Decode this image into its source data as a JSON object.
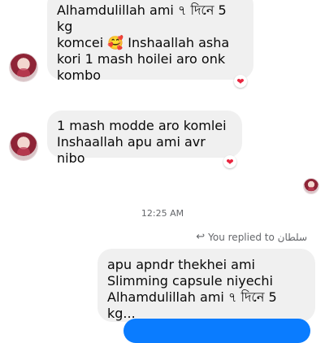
{
  "messages": [
    {
      "text": "Alhamdulillah ami ৭ দিনে 5 kg\nkomcei 🥰 Inshaallah asha\nkori 1 mash hoilei aro onk\nkombo",
      "reaction": "❤"
    },
    {
      "text": "1 mash modde aro komlei\nInshaallah apu ami avr nibo",
      "reaction": "❤"
    }
  ],
  "timestamp": "12:25 AM",
  "reply": {
    "label": "You replied to سلطان",
    "text": "apu apndr thekhei ami\nSlimming capsule niyechi\nAlhamdulillah ami ৭ দিনে 5 kg..."
  },
  "colors": {
    "bubble_gray": "#f0f0f0",
    "sent_blue": "#0a7cff",
    "heart_red": "#e8263f"
  }
}
